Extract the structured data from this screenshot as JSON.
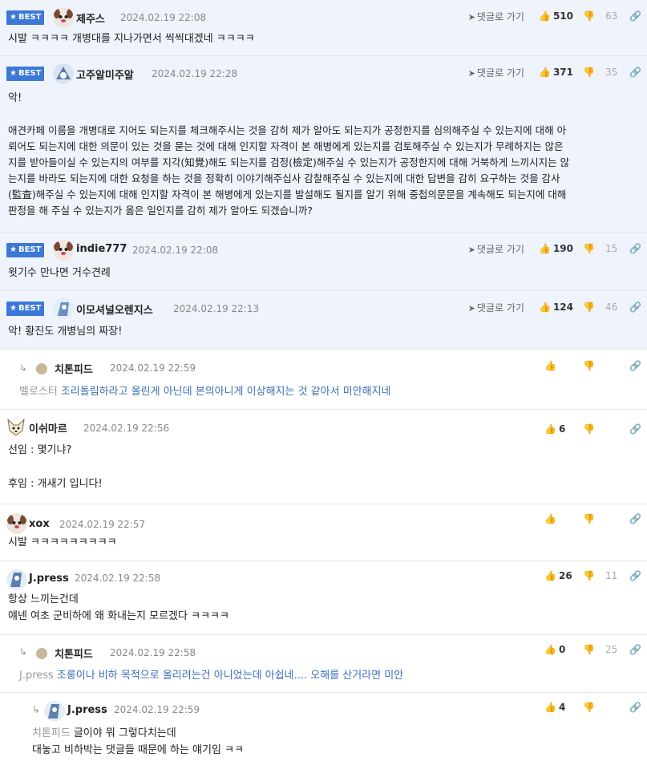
{
  "labels": {
    "best": "BEST",
    "goto": "댓글로 가기"
  },
  "icons": {
    "star": "star-icon",
    "thumbs_up": "thumbs-up-icon",
    "thumbs_down": "thumbs-down-icon",
    "link": "link-icon",
    "reply_arrow": "reply-arrow-icon",
    "goto": "paper-plane-icon"
  },
  "colors": {
    "best_bg": "#eef3fc",
    "badge": "#3c78d8",
    "mention": "#3c6fb8"
  },
  "comments": [
    {
      "nick": "제주스",
      "date": "2024.02.19 22:08",
      "up": "510",
      "down": "63",
      "text": "시발 ㅋㅋㅋㅋ 개병대를 지나가면서 씩씩대겠네 ㅋㅋㅋㅋ"
    },
    {
      "nick": "고주알미주알",
      "date": "2024.02.19 22:28",
      "up": "371",
      "down": "35",
      "line1": "악!",
      "line2": "애견카페 이름을 개병대로 지어도 되는지를 체크해주시는 것을 감히 제가 알아도 되는지가 공정한지를 심의해주실 수 있는지에 대해 아\n뢰어도 되는지에 대한 의문이 있는 것을 묻는 것에 대해 인지할 자격이 본 해병에게 있는지를 검토해주실 수 있는지가 무례하지는 않은\n지를 받아들이실 수 있는지의 여부를 지각(知覺)해도 되는지를 검정(檢定)해주실 수 있는지가 공정한지에 대해 거북하게 느끼시지는 않\n는지를 바라도 되는지에 대한 요청을 하는 것을 정확히 이야기해주십사 감찰해주실 수 있는지에 대한 답변을 감히 요구하는 것을 감사\n(監査)해주실 수 있는지에 대해 인지할 자격이 본 해병에게 있는지를 발설해도 될지를 알기 위해 중첩의문문을 계속해도 되는지에 대해\n판정을 해 주실 수 있는지가 옳은 일인지를 감히 제가 알아도 되겠습니까?"
    },
    {
      "nick": "indie777",
      "date": "2024.02.19 22:08",
      "up": "190",
      "down": "15",
      "text": "윗기수 만나면 거수견례"
    },
    {
      "nick": "이모셔널오렌지스",
      "date": "2024.02.19 22:13",
      "up": "124",
      "down": "46",
      "text": "악! 황진도 개병님의 짜장!"
    },
    {
      "nick": "치톤피드",
      "date": "2024.02.19 22:59",
      "up": "",
      "down": "",
      "ref": "벨로스터",
      "text": "조리돌림하라고 올린게 아닌데 본의아니게 이상해지는 것 같아서 미안해지네"
    },
    {
      "nick": "이쉬마르",
      "date": "2024.02.19 22:56",
      "up": "6",
      "down": "",
      "line1": "선임 : 몇기냐?",
      "line2": "후임 : 개새기 입니다!"
    },
    {
      "nick": "xox",
      "date": "2024.02.19 22:57",
      "up": "",
      "down": "",
      "text": "시발 ㅋㅋㅋㅋㅋㅋㅋㅋㅋ"
    },
    {
      "nick": "J.press",
      "date": "2024.02.19 22:58",
      "up": "26",
      "down": "11",
      "text": "항상 느끼는건데\n얘넨 여초 군비하에 왜 화내는지 모르겠다 ㅋㅋㅋㅋ"
    },
    {
      "nick": "치톤피드",
      "date": "2024.02.19 22:58",
      "up": "0",
      "down": "25",
      "ref": "J.press",
      "text": "조롱이나 비하 목적으로 올리려는건 아니었는데 아쉽네.... 오해를 산거라면 미안"
    },
    {
      "nick": "J.press",
      "date": "2024.02.19 22:59",
      "up": "4",
      "down": "",
      "ref": "치톤피드",
      "line1": "글이야 뭐 그렇다치는데",
      "line2": "대놓고 비하박는 댓글들 때문에 하는 얘기임 ㅋㅋ"
    }
  ]
}
